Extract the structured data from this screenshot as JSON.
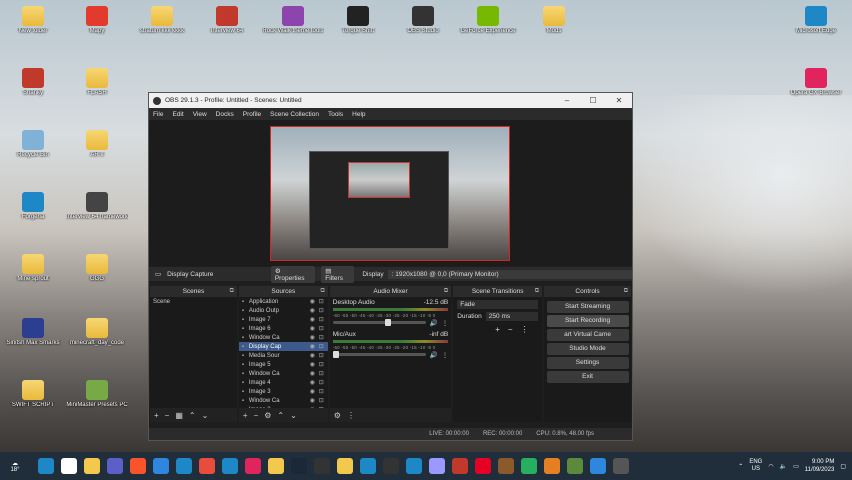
{
  "desktop_icons": [
    {
      "label": "New folder",
      "icon": "folder-icon",
      "color": "#f2c94c"
    },
    {
      "label": "Mapy",
      "icon": "mapy-icon",
      "color": "#e23b2e"
    },
    {
      "label": "stratum kkk kkkk",
      "icon": "folder-icon",
      "color": "#f2c94c"
    },
    {
      "label": "Interview 64",
      "icon": "game-icon",
      "color": "#c0392b"
    },
    {
      "label": "Rock Walk theme tools",
      "icon": "app-icon",
      "color": "#8e44ad"
    },
    {
      "label": "Torque Shift",
      "icon": "torque-icon",
      "color": "#222"
    },
    {
      "label": "OBS Studio",
      "icon": "obs-icon",
      "color": "#333"
    },
    {
      "label": "GeForce Experience",
      "icon": "nvidia-icon",
      "color": "#76b900"
    },
    {
      "label": "Mods",
      "icon": "folder-icon",
      "color": "#f2c94c"
    },
    {
      "label": "Microsoft Edge",
      "icon": "edge-icon",
      "color": "#1e88c7"
    },
    {
      "label": "Shanky",
      "icon": "app-icon",
      "color": "#c0392b"
    },
    {
      "label": "FLASH",
      "icon": "folder-icon",
      "color": "#f2c94c"
    },
    {
      "label": "Opera GX Browser",
      "icon": "opera-icon",
      "color": "#e0245e"
    },
    {
      "label": "Recycle Bin",
      "icon": "recycle-bin-icon",
      "color": "#7fb2d6"
    },
    {
      "label": "AR II",
      "icon": "folder-icon",
      "color": "#f2c94c"
    },
    {
      "label": "Forgeria",
      "icon": "app-icon",
      "color": "#1e88c7"
    },
    {
      "label": "Interview 64 frameworks",
      "icon": "panda-icon",
      "color": "#444"
    },
    {
      "label": "Mine sprout",
      "icon": "folder-icon",
      "color": "#f2c94c"
    },
    {
      "label": "GGG",
      "icon": "folder-icon",
      "color": "#f2c94c"
    },
    {
      "label": "Sinitsh Max Smarks",
      "icon": "app-icon",
      "color": "#2c3e90"
    },
    {
      "label": "minecraft_day_code",
      "icon": "folder-icon",
      "color": "#f2c94c"
    },
    {
      "label": "SWIFT SCRIPT",
      "icon": "folder-icon",
      "color": "#f2c94c"
    },
    {
      "label": "MiniMaster Presets PC",
      "icon": "app-icon",
      "color": "#7a4"
    }
  ],
  "obs": {
    "title": "OBS 29.1.3 - Profile: Untitled - Scenes: Untitled",
    "menu": [
      "File",
      "Edit",
      "View",
      "Docks",
      "Profile",
      "Scene Collection",
      "Tools",
      "Help"
    ],
    "source_toolbar": {
      "source_name": "Display Capture",
      "properties": "Properties",
      "filters": "Filters",
      "display_label": "Display",
      "display_value": ": 1920x1080 @ 0,0 (Primary Monitor)"
    },
    "docks": {
      "scenes": "Scenes",
      "sources": "Sources",
      "mixer": "Audio Mixer",
      "transitions": "Scene Transitions",
      "controls": "Controls"
    },
    "scenes": [
      "Scene"
    ],
    "sources": [
      {
        "name": "Application",
        "icon": "application-icon"
      },
      {
        "name": "Audio Outp",
        "icon": "speaker-icon"
      },
      {
        "name": "Image 7",
        "icon": "image-icon"
      },
      {
        "name": "Image 6",
        "icon": "image-icon"
      },
      {
        "name": "Window Ca",
        "icon": "window-icon"
      },
      {
        "name": "Display Cap",
        "icon": "monitor-icon"
      },
      {
        "name": "Media Sour",
        "icon": "media-icon"
      },
      {
        "name": "Image 5",
        "icon": "image-icon"
      },
      {
        "name": "Window Ca",
        "icon": "window-icon"
      },
      {
        "name": "Image 4",
        "icon": "image-icon"
      },
      {
        "name": "Image 3",
        "icon": "image-icon"
      },
      {
        "name": "Window Ca",
        "icon": "window-icon"
      },
      {
        "name": "Image 2",
        "icon": "image-icon"
      }
    ],
    "mixer": [
      {
        "name": "Desktop Audio",
        "db": "-12.5 dB",
        "level": 0.62,
        "muted": false
      },
      {
        "name": "Mic/Aux",
        "db": "-inf dB",
        "level": 0.0,
        "muted": true
      }
    ],
    "mixer_scale": "-60 -55 -50 -45 -40 -35 -30 -25 -20 -15 -10 -5 0",
    "transitions": {
      "type": "Fade",
      "duration_label": "Duration",
      "duration_value": "250 ms"
    },
    "controls": [
      "Start Streaming",
      "Start Recording",
      "art Virtual Came",
      "Studio Mode",
      "Settings",
      "Exit"
    ],
    "status": {
      "live": "LIVE: 00:00:00",
      "rec": "REC: 00:00:00",
      "cpu": "CPU: 0.8%, 48.00 fps"
    }
  },
  "taskbar": {
    "weather": "18°",
    "apps": [
      "windows-icon",
      "search-icon",
      "file-explorer-icon",
      "teams-icon",
      "brave-icon",
      "apps-icon",
      "store-icon",
      "chrome-icon",
      "edge-icon",
      "opera-icon",
      "folder-icon",
      "steam-icon",
      "epic-icon",
      "files-icon",
      "app-icon",
      "obs-icon",
      "edge2-icon",
      "premiere-icon",
      "game-icon",
      "pinterest-icon",
      "freddy-icon",
      "app2-icon",
      "app3-icon",
      "minecraft-icon",
      "photos-icon",
      "more-icon"
    ],
    "lang_top": "ENG",
    "lang_bottom": "US",
    "time": "9:00 PM",
    "date": "11/09/2023"
  }
}
